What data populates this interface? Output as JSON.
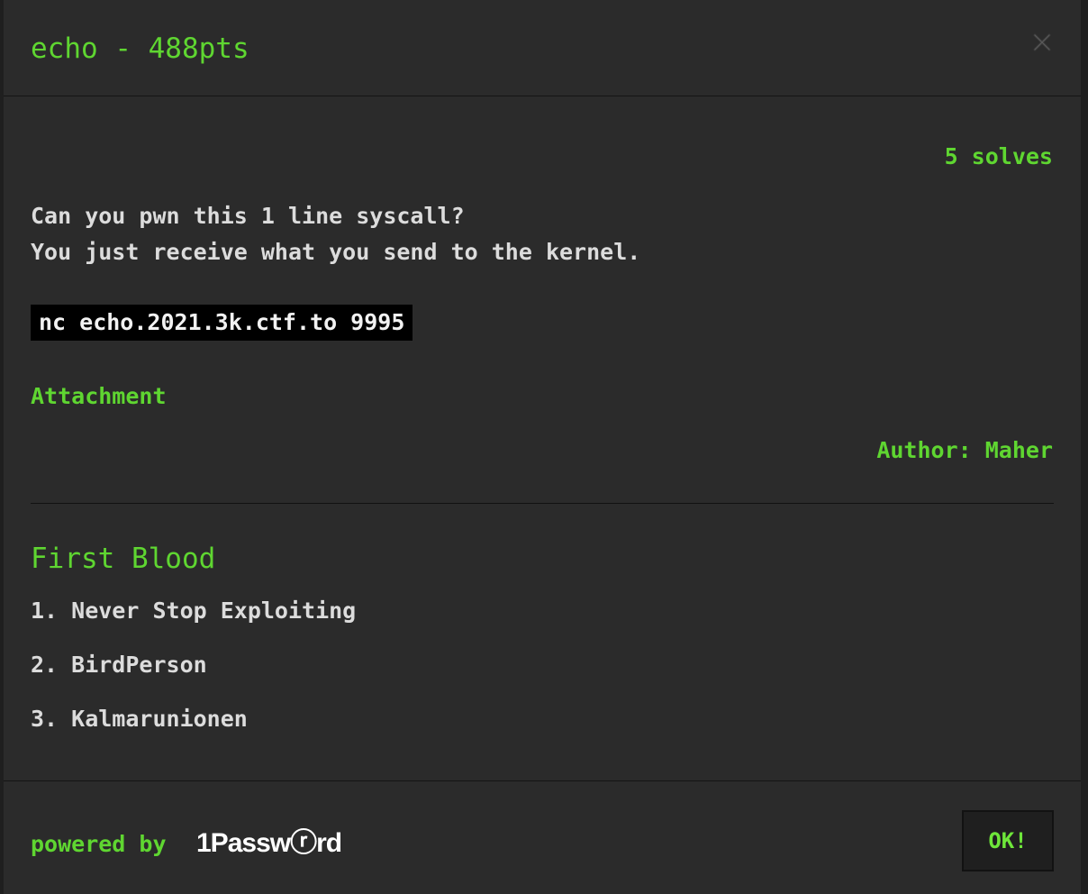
{
  "modal": {
    "title": "echo - 488pts",
    "close_icon": "close-icon"
  },
  "challenge": {
    "solves": "5 solves",
    "description_lines": [
      "Can you pwn this 1 line syscall?",
      "You just receive what you send to the kernel."
    ],
    "command": "nc echo.2021.3k.ctf.to 9995",
    "attachment_label": "Attachment",
    "author": "Author: Maher"
  },
  "first_blood": {
    "heading": "First Blood",
    "entries": [
      "1. Never Stop Exploiting",
      "2. BirdPerson",
      "3. Kalmarunionen"
    ]
  },
  "footer": {
    "powered_by": "powered by",
    "brand_logo_text": "1Passwⓡrd",
    "ok_label": "OK!"
  },
  "colors": {
    "accent_green": "#5fd631",
    "modal_background": "#2b2b2b",
    "text_light": "#dcdcdc",
    "command_background": "#000000"
  }
}
